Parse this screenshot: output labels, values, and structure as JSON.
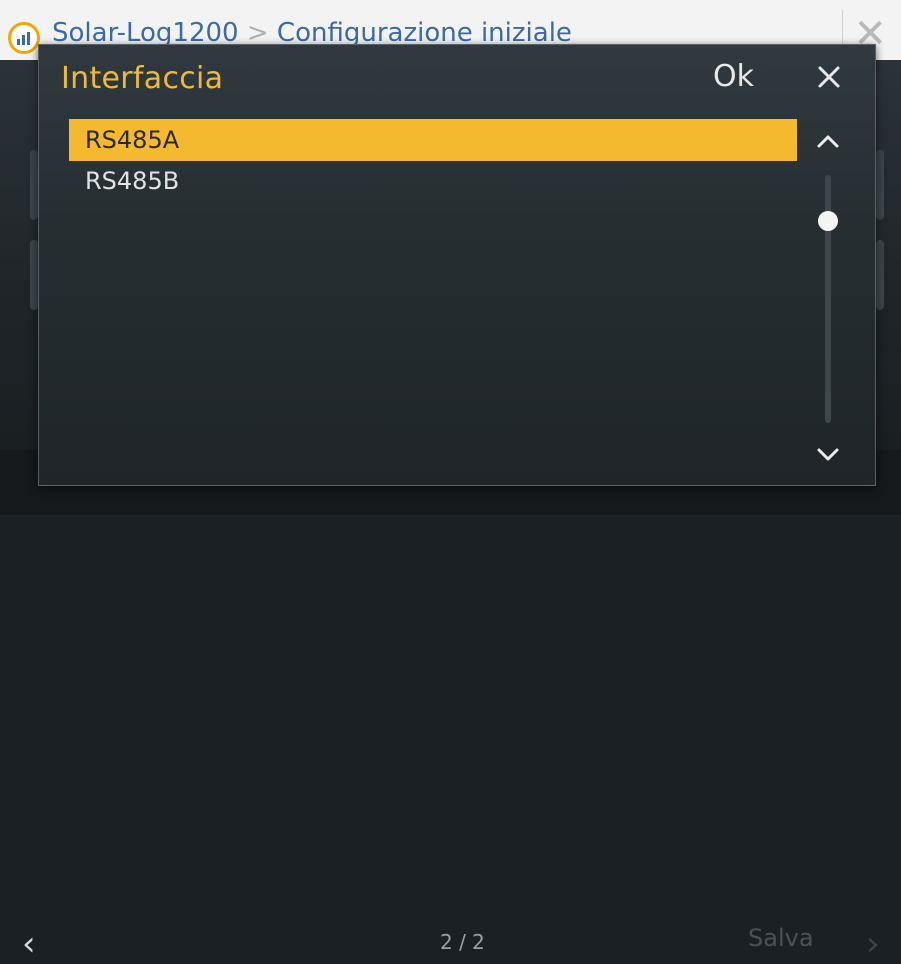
{
  "header": {
    "breadcrumb_device": "Solar-Log1200",
    "breadcrumb_separator": ">",
    "breadcrumb_page": "Configurazione iniziale",
    "logo_icon": "solar-log-chart-icon",
    "close_icon": "close-icon"
  },
  "footer": {
    "page_indicator": "2 / 2",
    "save_label": "Salva"
  },
  "dialog": {
    "title": "Interfaccia",
    "ok_label": "Ok",
    "close_icon": "close-icon",
    "options": [
      {
        "label": "RS485A",
        "selected": true
      },
      {
        "label": "RS485B",
        "selected": false
      }
    ],
    "selected_value": "RS485A",
    "scroll_up_icon": "chevron-up-icon",
    "scroll_down_icon": "chevron-down-icon"
  },
  "colors": {
    "accent": "#f4b92e",
    "title": "#f0ba37",
    "dialog_bg": "#283034",
    "text": "#e6e6e6"
  }
}
